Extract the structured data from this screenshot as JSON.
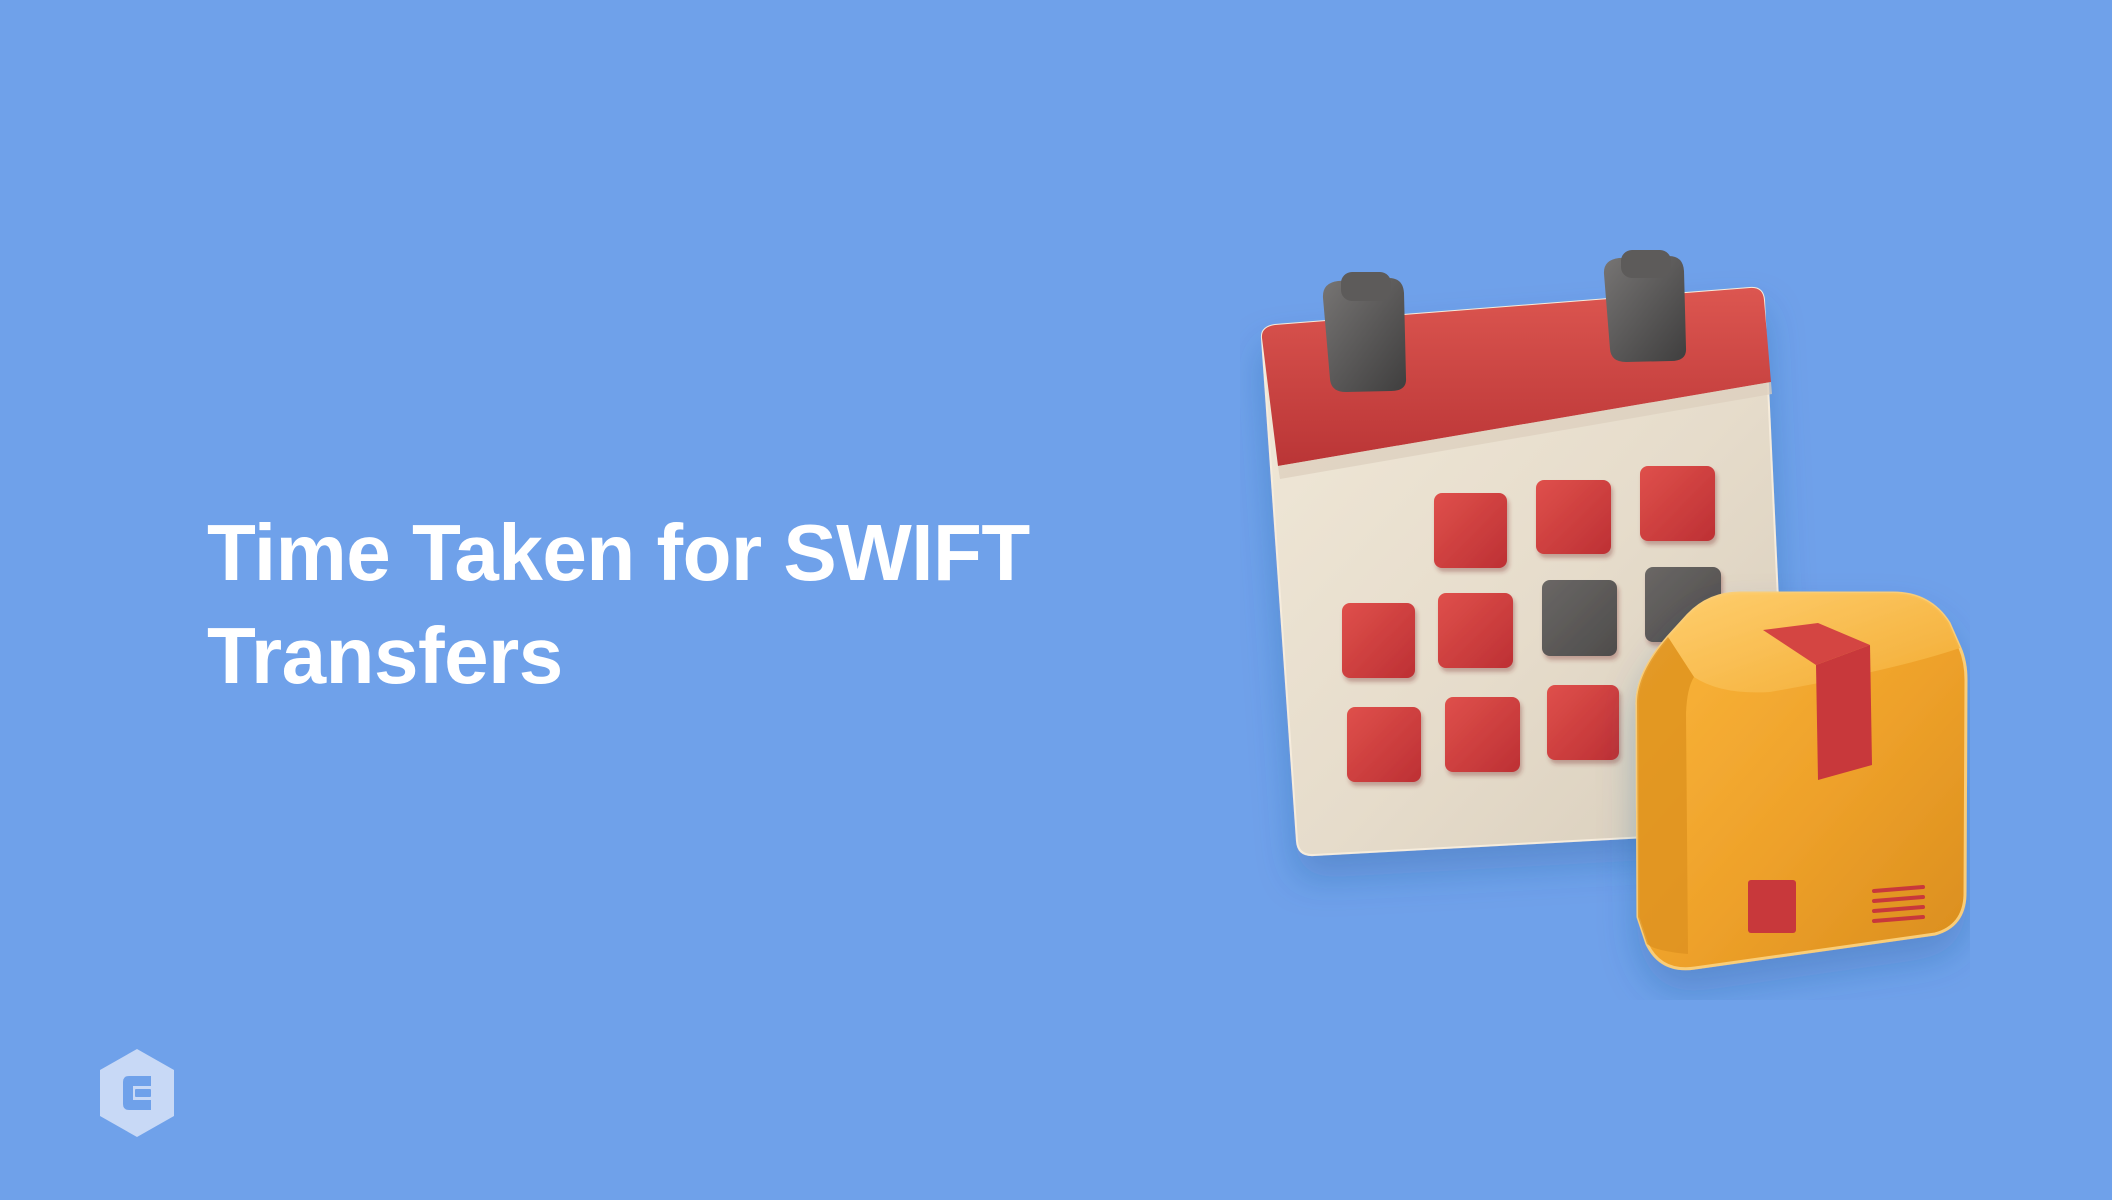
{
  "hero": {
    "title_line_1": "Time Taken for SWIFT",
    "title_line_2": "Transfers"
  },
  "colors": {
    "background": "#6fa1ea",
    "title": "#ffffff",
    "calendar_red": "#c9423d",
    "calendar_paper": "#e8e0d1",
    "calendar_dark_tile": "#5c5a59",
    "box_orange": "#f1a52a",
    "box_tape_red": "#c8373b",
    "logo": "#c8d9f6"
  },
  "icons": {
    "logo": "brand-hexagon-logo-icon",
    "calendar": "calendar-icon",
    "package": "package-box-icon"
  }
}
